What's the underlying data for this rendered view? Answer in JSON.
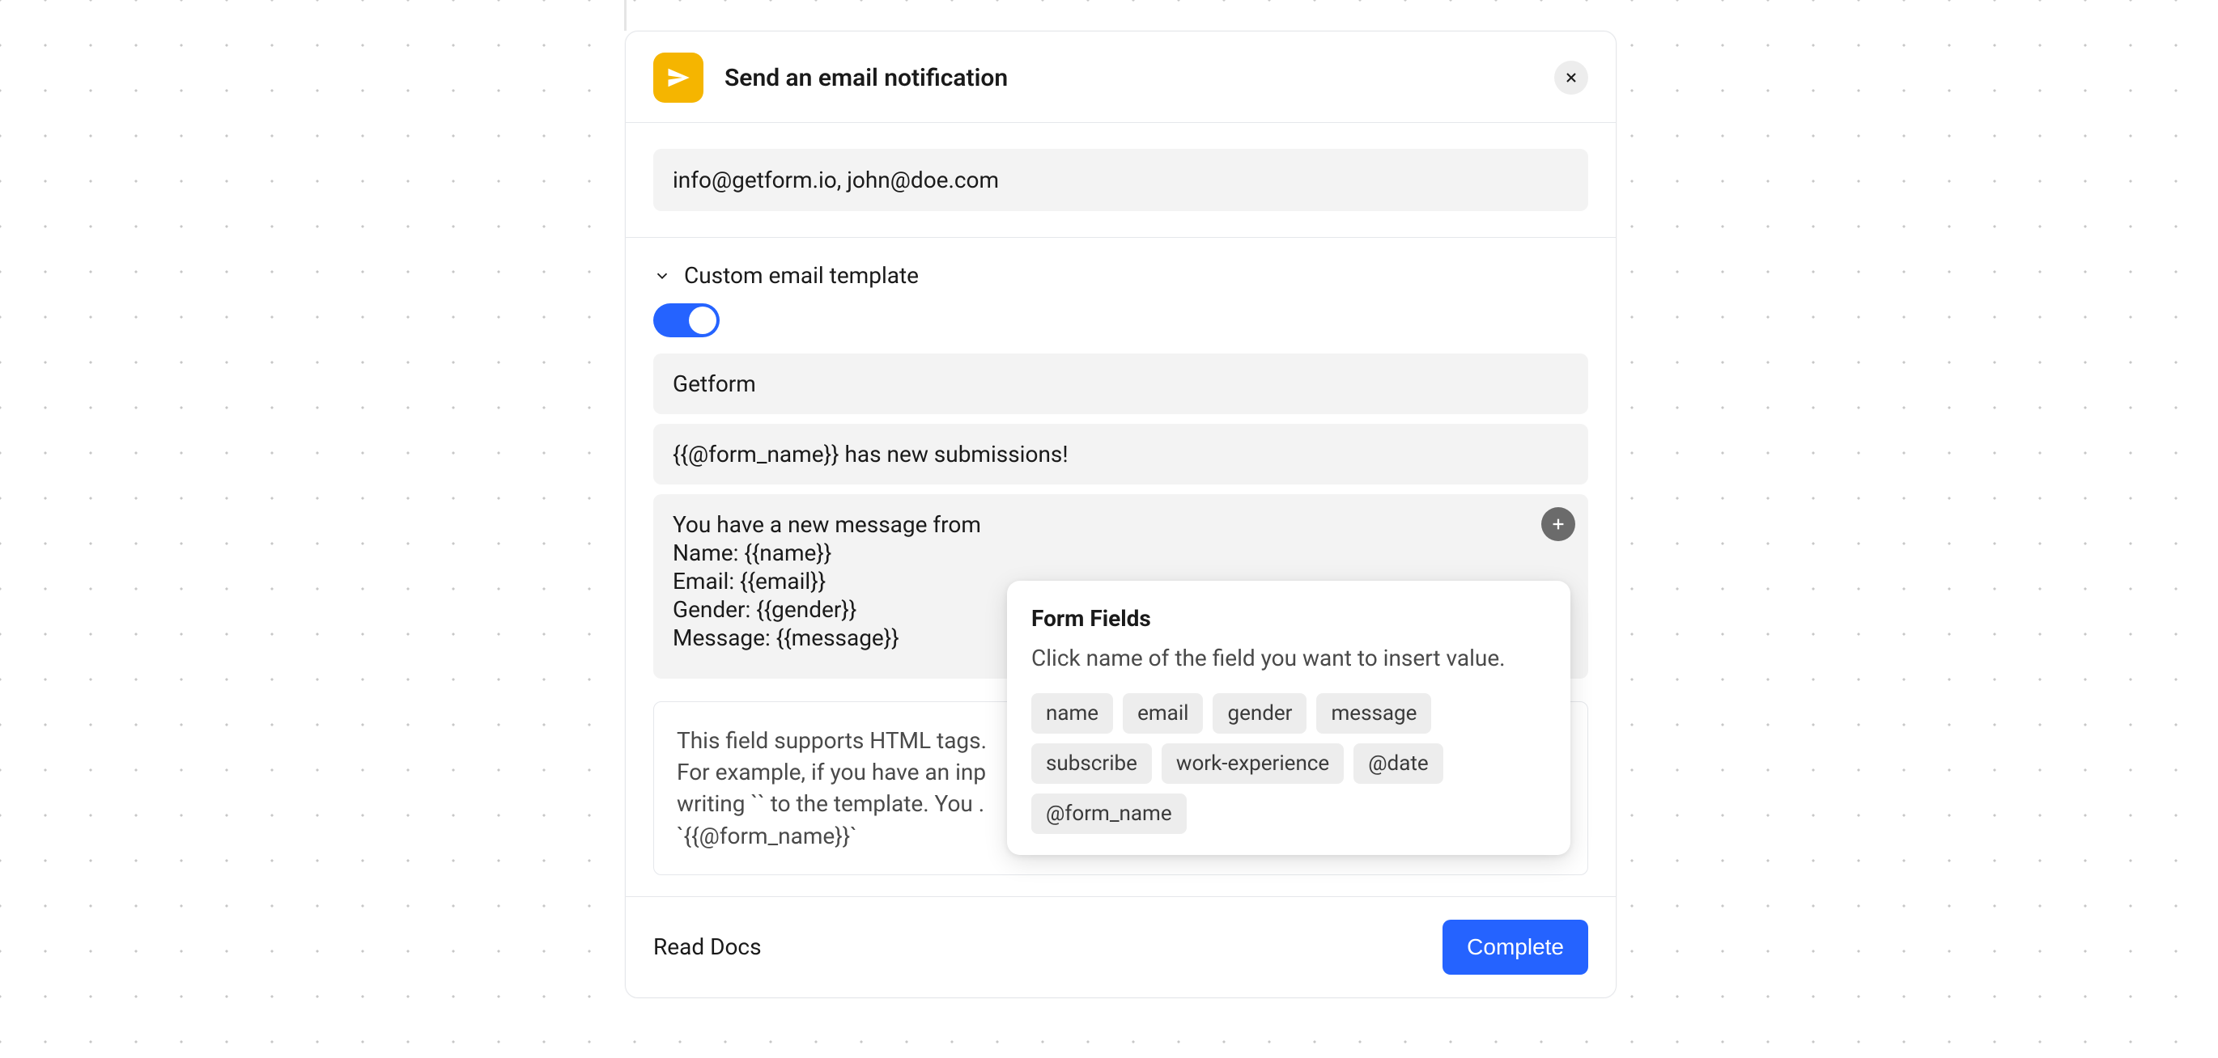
{
  "header": {
    "title": "Send an email notification"
  },
  "recipients": {
    "value": "info@getform.io, john@doe.com"
  },
  "template": {
    "section_label": "Custom email template",
    "toggle_on": true,
    "from_name": "Getform",
    "subject": "{{@form_name}} has new submissions!",
    "body": "You have a new message from\nName: {{name}}\nEmail: {{email}}\nGender: {{gender}}\nMessage: {{message}}"
  },
  "help": {
    "text": "This field supports HTML tags.\nFor example, if you have an inp\nwriting `` to the template. You .\n`{{@form_name}}`"
  },
  "popover": {
    "title": "Form Fields",
    "description": "Click name of the field you want to insert value.",
    "fields": [
      "name",
      "email",
      "gender",
      "message",
      "subscribe",
      "work-experience",
      "@date",
      "@form_name"
    ]
  },
  "footer": {
    "docs_label": "Read Docs",
    "complete_label": "Complete"
  }
}
